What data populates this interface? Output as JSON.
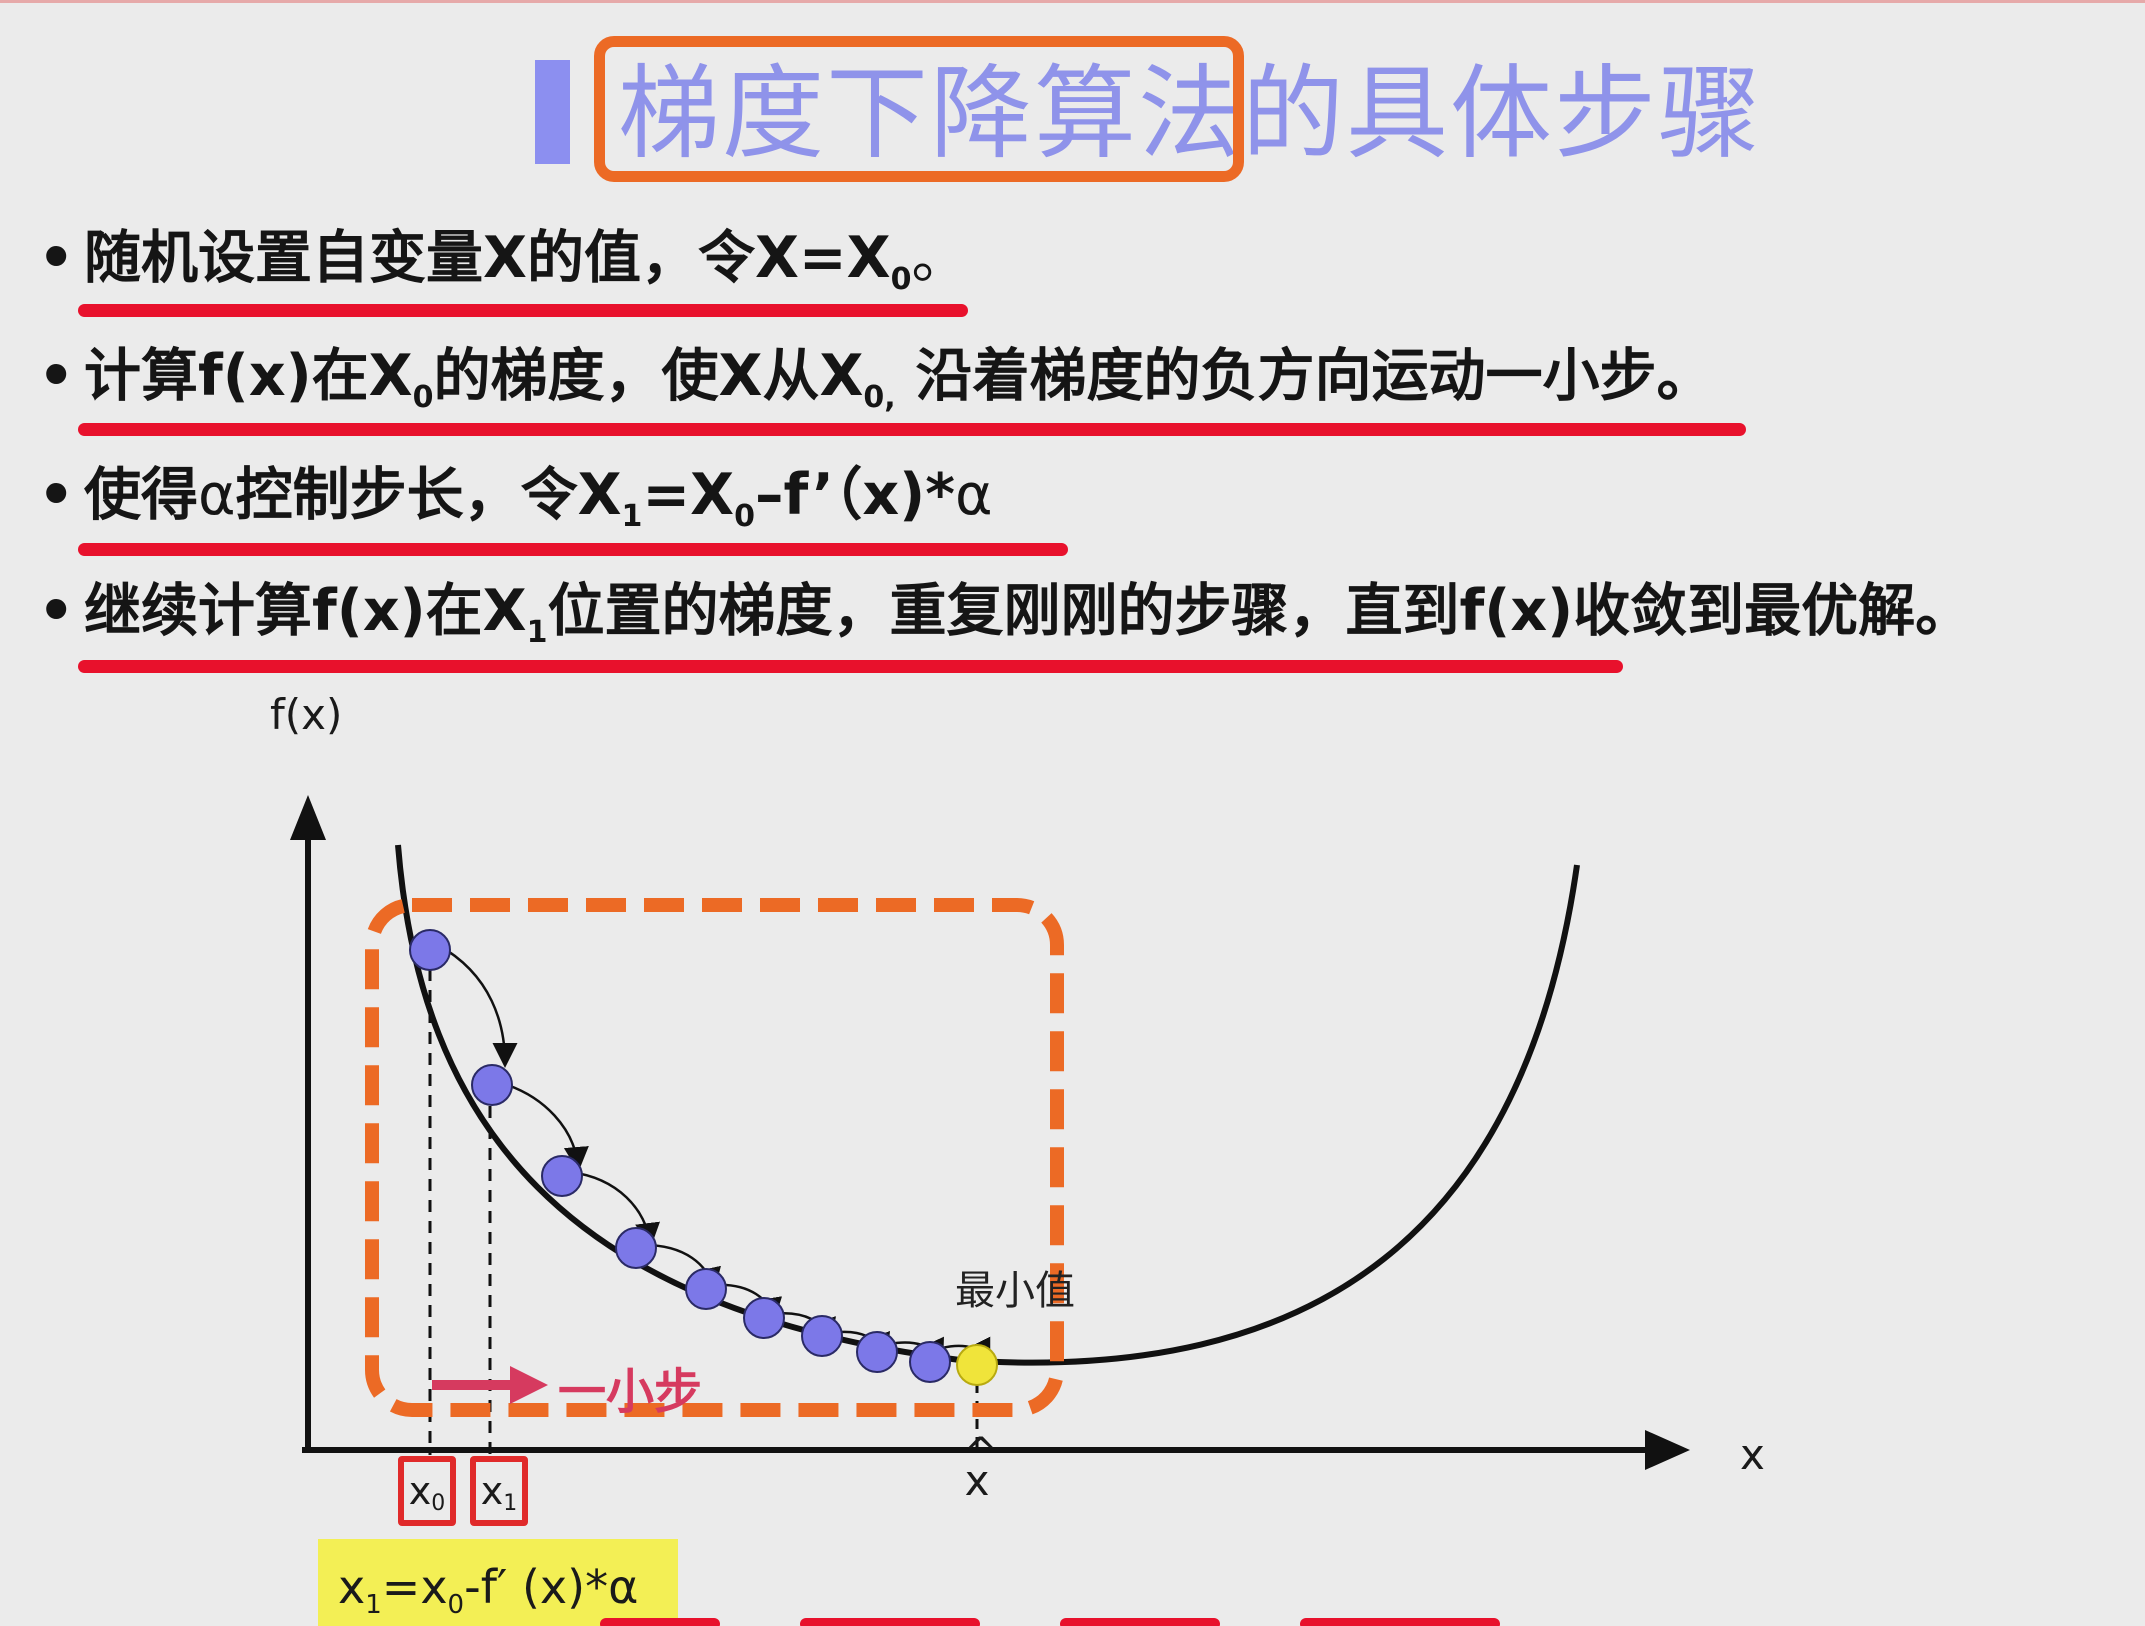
{
  "title": {
    "boxed": "梯度下降算法",
    "rest": "的具体步骤"
  },
  "bullets": [
    {
      "a": "随机设置自变量X的值，令X=X",
      "sub": "0",
      "b": "。"
    },
    {
      "a": "计算f(x)在X",
      "sub": "0",
      "b": "的梯度，使X从X",
      "sub2": "0,",
      "c": " 沿着梯度的负方向运动一小步。"
    },
    {
      "a": "使得",
      "alpha": "α",
      "b": "控制步长，令X",
      "sub": "1",
      "c": "=X",
      "sub2": "0",
      "d": "–f’（x)*",
      "alpha2": "α"
    },
    {
      "a": "继续计算f(x)在X",
      "sub": "1",
      "b": "位置的梯度，重复刚刚的步骤，直到f(x)收敛到最优解。"
    }
  ],
  "diagram": {
    "y_axis_label": "f(x)",
    "x_axis_label": "x",
    "minimum_label": "最小值",
    "step_label": "一小步",
    "x0_label": {
      "main": "x",
      "sub": "0"
    },
    "x1_label": {
      "main": "x",
      "sub": "1"
    },
    "xhat_label": {
      "main": "x",
      "hat": "^"
    },
    "formula": {
      "x": "x",
      "s1": "1",
      "eq": "=x",
      "s0": "0",
      "rest": "-f′ (x)*α"
    },
    "colors": {
      "title": "#8f93ea",
      "title_box": "#ec6a25",
      "underline": "#e8112c",
      "dashed_box": "#ec6a25",
      "point": "#7c78e8",
      "minimum_point": "#f0e43a",
      "step_arrow": "#d63a5f",
      "formula_bg": "#f3ef55"
    }
  }
}
